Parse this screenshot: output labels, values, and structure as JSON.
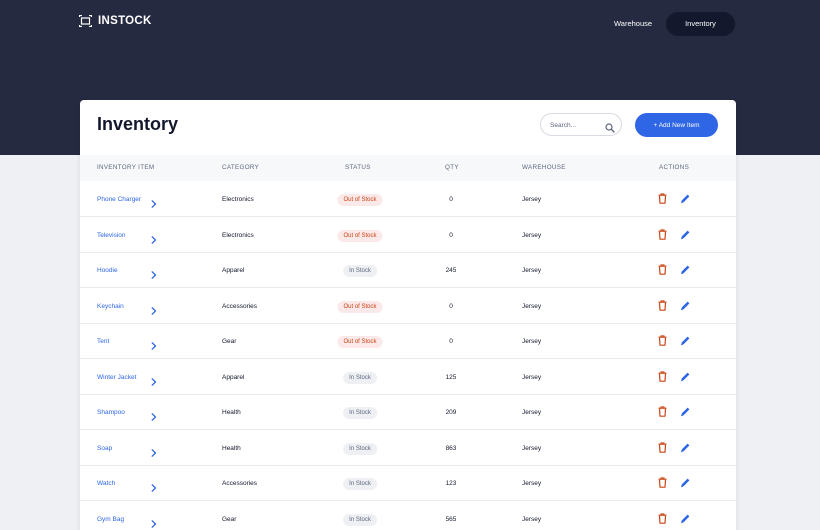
{
  "header": {
    "brand": "INSTOCK",
    "nav": [
      {
        "label": "Warehouse",
        "active": false
      },
      {
        "label": "Inventory",
        "active": true
      }
    ]
  },
  "page": {
    "title": "Inventory",
    "search_placeholder": "Search...",
    "add_button": "+ Add New Item"
  },
  "columns": [
    "Inventory Item",
    "Category",
    "Status",
    "Qty",
    "Warehouse",
    "Actions"
  ],
  "rows": [
    {
      "item": "Phone Charger",
      "category": "Electronics",
      "status": "Out of Stock",
      "qty": "0",
      "warehouse": "Jersey"
    },
    {
      "item": "Television",
      "category": "Electronics",
      "status": "Out of Stock",
      "qty": "0",
      "warehouse": "Jersey"
    },
    {
      "item": "Hoodie",
      "category": "Apparel",
      "status": "In Stock",
      "qty": "245",
      "warehouse": "Jersey"
    },
    {
      "item": "Keychain",
      "category": "Accessories",
      "status": "Out of Stock",
      "qty": "0",
      "warehouse": "Jersey"
    },
    {
      "item": "Tent",
      "category": "Gear",
      "status": "Out of Stock",
      "qty": "0",
      "warehouse": "Jersey"
    },
    {
      "item": "Winter Jacket",
      "category": "Apparel",
      "status": "In Stock",
      "qty": "125",
      "warehouse": "Jersey"
    },
    {
      "item": "Shampoo",
      "category": "Health",
      "status": "In Stock",
      "qty": "209",
      "warehouse": "Jersey"
    },
    {
      "item": "Soap",
      "category": "Health",
      "status": "In Stock",
      "qty": "863",
      "warehouse": "Jersey"
    },
    {
      "item": "Watch",
      "category": "Accessories",
      "status": "In Stock",
      "qty": "123",
      "warehouse": "Jersey"
    },
    {
      "item": "Gym Bag",
      "category": "Gear",
      "status": "In Stock",
      "qty": "565",
      "warehouse": "Jersey"
    }
  ],
  "icons": {
    "brand": "warehouse-logo-icon",
    "search": "search-icon",
    "row_link": "chevron-right-icon",
    "delete": "trash-icon",
    "edit": "pencil-icon"
  },
  "colors": {
    "header_bg": "#262a41",
    "accent": "#2e66e5",
    "text": "#13182c",
    "muted": "#5c667e",
    "out_of_stock": "#c94515",
    "out_of_stock_bg": "#fbe8e8",
    "in_stock_bg": "#eef0f3",
    "delete_icon": "#c94515"
  }
}
